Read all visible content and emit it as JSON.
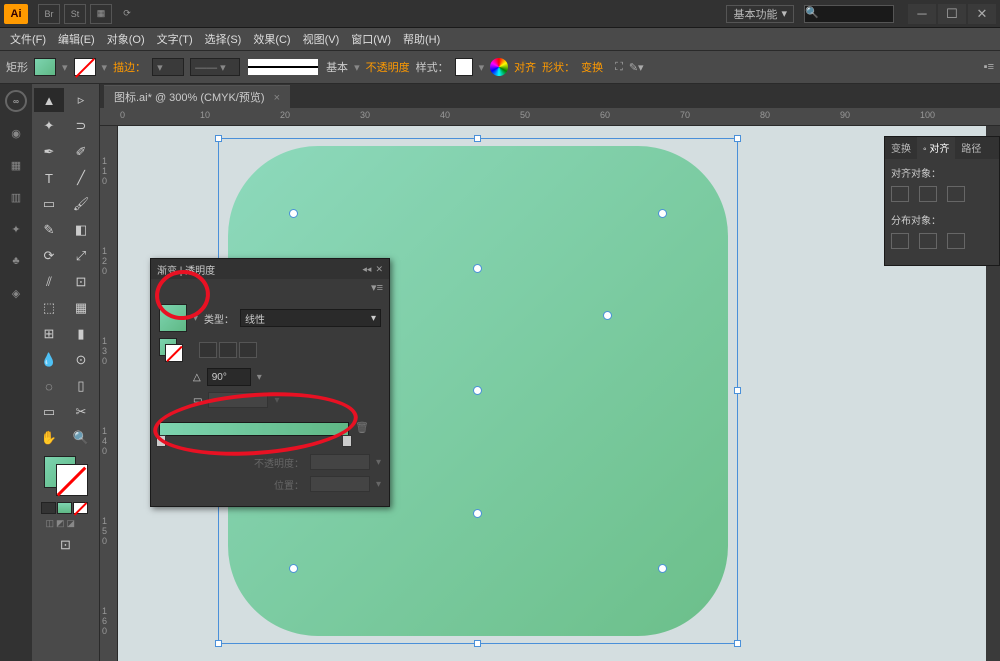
{
  "app": {
    "logo": "Ai",
    "workspace": "基本功能"
  },
  "menu": [
    "文件(F)",
    "编辑(E)",
    "对象(O)",
    "文字(T)",
    "选择(S)",
    "效果(C)",
    "视图(V)",
    "窗口(W)",
    "帮助(H)"
  ],
  "control": {
    "shape_label": "矩形",
    "stroke_label": "描边：",
    "stroke_style": "基本",
    "opacity_label": "不透明度",
    "style_label": "样式：",
    "align_label": "对齐",
    "shape_btn": "形状：",
    "transform_label": "变换"
  },
  "document": {
    "tab": "图标.ai* @ 300% (CMYK/预览)"
  },
  "ruler_h": [
    "0",
    "10",
    "20",
    "30",
    "40",
    "50",
    "60",
    "70",
    "80",
    "90",
    "100"
  ],
  "ruler_v": [
    "1\n1\n0",
    "1\n2\n0",
    "1\n3\n0",
    "1\n4\n0",
    "1\n5\n0",
    "1\n6\n0"
  ],
  "gradient_panel": {
    "title": "渐变 | 透明度",
    "type_label": "类型：",
    "type_value": "线性",
    "angle_value": "90°",
    "opacity_label": "不透明度：",
    "position_label": "位置："
  },
  "right_panel": {
    "tabs": [
      "变换",
      "对齐",
      "路径"
    ],
    "align_objects": "对齐对象：",
    "distribute_objects": "分布对象："
  },
  "colors": {
    "gradient_start": "#8dd9bc",
    "gradient_end": "#6cbf8a"
  }
}
